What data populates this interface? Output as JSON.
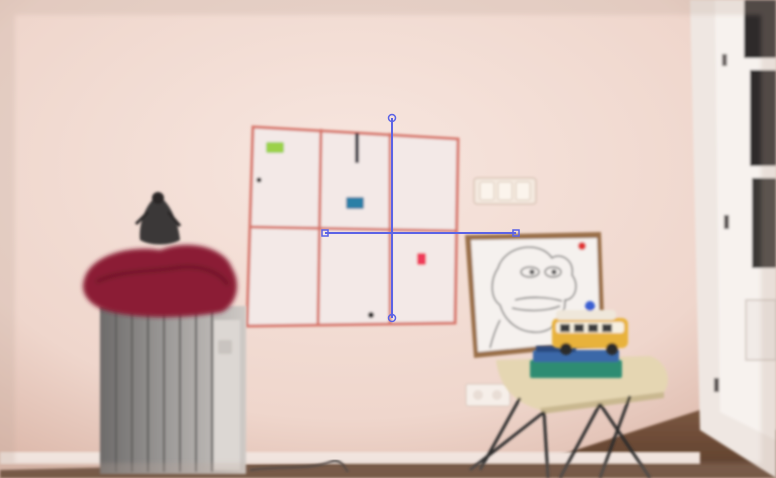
{
  "scene": {
    "description_free": true
  },
  "colors": {
    "wall": "#f2dcd4",
    "wall_shadow": "#e3c3b8",
    "floor": "#6b4a35",
    "board_frame": "#d7776c",
    "board_paper": "#f3e9e7",
    "overlay_line": "#5b63e6",
    "door": "#f3eeea",
    "door_glass": "#2d2b2a",
    "blanket": "#8b1f34",
    "radiator": "#8f8c8a",
    "picture_frame": "#9a6f4a",
    "stool_seat": "#e5d6b2",
    "stool_legs": "#2b2a2c",
    "toy_bus": "#e8b23b",
    "books": "#2e8c72",
    "marker_green": "#9bd14a",
    "marker_blue": "#2c7fa6",
    "marker_red": "#ef3b5a"
  },
  "overlay": {
    "vertical_handle_top": true,
    "vertical_handle_bottom": true,
    "horizontal_handle_left": true,
    "horizontal_handle_right": true
  }
}
